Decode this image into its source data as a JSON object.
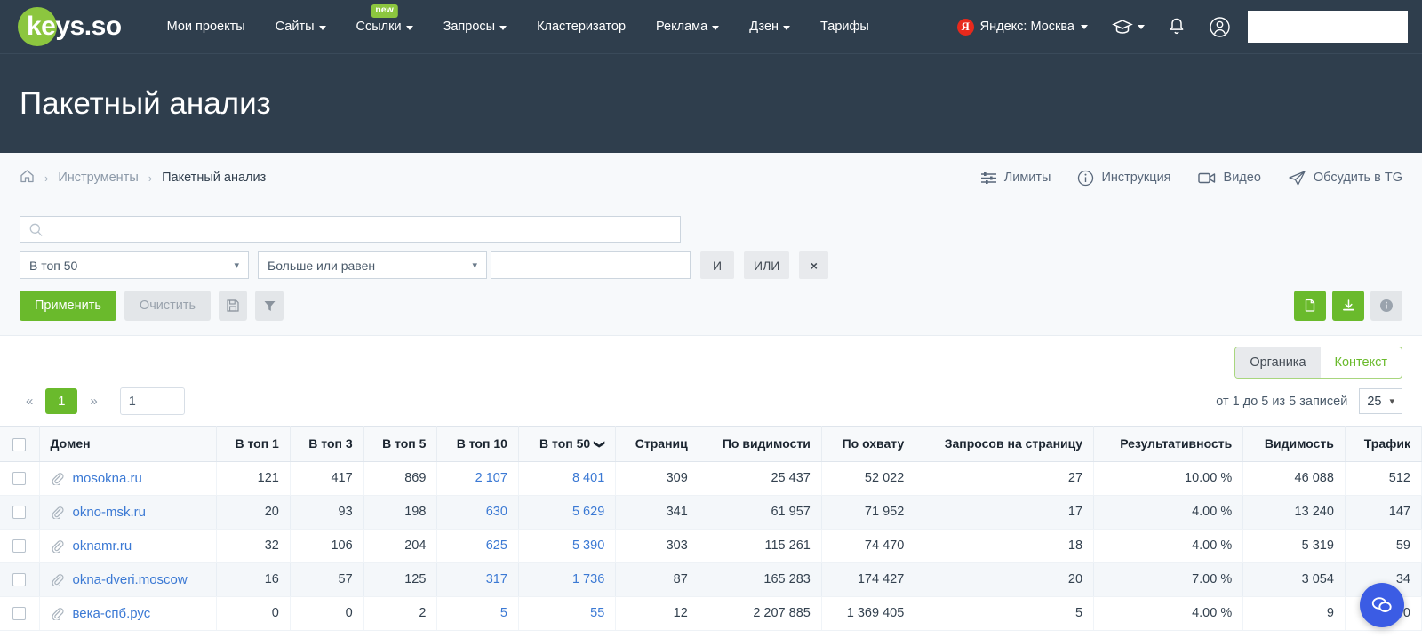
{
  "brand": {
    "logo_text": "keys.so",
    "logo_green": "#8cc63f"
  },
  "nav": {
    "items": [
      {
        "label": "Мои проекты",
        "caret": false,
        "badge": null
      },
      {
        "label": "Сайты",
        "caret": true,
        "badge": null
      },
      {
        "label": "Ссылки",
        "caret": true,
        "badge": "new"
      },
      {
        "label": "Запросы",
        "caret": true,
        "badge": null
      },
      {
        "label": "Кластеризатор",
        "caret": false,
        "badge": null
      },
      {
        "label": "Реклама",
        "caret": true,
        "badge": null
      },
      {
        "label": "Дзен",
        "caret": true,
        "badge": null
      },
      {
        "label": "Тарифы",
        "caret": false,
        "badge": null
      }
    ],
    "region": {
      "letter": "Я",
      "label": "Яндекс: Москва"
    },
    "user_search_value": ""
  },
  "header": {
    "title": "Пакетный анализ"
  },
  "breadcrumb": {
    "home": "home-icon",
    "items": [
      {
        "label": "Инструменты",
        "current": false
      },
      {
        "label": "Пакетный анализ",
        "current": true
      }
    ],
    "actions": [
      {
        "label": "Лимиты",
        "icon": "sliders-icon"
      },
      {
        "label": "Инструкция",
        "icon": "info-circle-icon"
      },
      {
        "label": "Видео",
        "icon": "video-camera-icon"
      },
      {
        "label": "Обсудить в TG",
        "icon": "telegram-send-icon"
      }
    ]
  },
  "filters": {
    "search_value": "",
    "search_placeholder": "",
    "metric_select": "В топ 50",
    "operator_select": "Больше или равен",
    "value_input": "",
    "value_placeholder": "",
    "and_label": "И",
    "or_label": "ИЛИ",
    "remove_label": "×",
    "apply_label": "Применить",
    "clear_label": "Очистить",
    "save_icon": "floppy-disk-icon",
    "filter_icon": "funnel-icon",
    "export_copy_icon": "document-copy-icon",
    "export_download_icon": "download-icon",
    "info_icon": "info-icon"
  },
  "tabs": {
    "items": [
      {
        "label": "Органика",
        "active": true
      },
      {
        "label": "Контекст",
        "active": false
      }
    ]
  },
  "pagination": {
    "prev": "«",
    "next": "»",
    "current_page": "1",
    "page_input_value": "1",
    "records_info": "от 1 до 5 из 5 записей",
    "page_size": "25"
  },
  "table": {
    "columns": [
      {
        "label": "Домен",
        "align": "left"
      },
      {
        "label": "В топ 1",
        "align": "right"
      },
      {
        "label": "В топ 3",
        "align": "right"
      },
      {
        "label": "В топ 5",
        "align": "right"
      },
      {
        "label": "В топ 10",
        "align": "right"
      },
      {
        "label": "В топ 50",
        "align": "right",
        "sorted": "desc"
      },
      {
        "label": "Страниц",
        "align": "right"
      },
      {
        "label": "По видимости",
        "align": "right"
      },
      {
        "label": "По охвату",
        "align": "right"
      },
      {
        "label": "Запросов на страницу",
        "align": "right"
      },
      {
        "label": "Результативность",
        "align": "right"
      },
      {
        "label": "Видимость",
        "align": "right"
      },
      {
        "label": "Трафик",
        "align": "right"
      }
    ],
    "rows": [
      {
        "domain": "mosokna.ru",
        "top1": "121",
        "top3": "417",
        "top5": "869",
        "top10": "2 107",
        "top50": "8 401",
        "pages": "309",
        "by_visibility": "25 437",
        "by_coverage": "52 022",
        "queries_per_page": "27",
        "effectiveness": "10.00 %",
        "visibility": "46 088",
        "traffic": "512"
      },
      {
        "domain": "okno-msk.ru",
        "top1": "20",
        "top3": "93",
        "top5": "198",
        "top10": "630",
        "top50": "5 629",
        "pages": "341",
        "by_visibility": "61 957",
        "by_coverage": "71 952",
        "queries_per_page": "17",
        "effectiveness": "4.00 %",
        "visibility": "13 240",
        "traffic": "147"
      },
      {
        "domain": "oknamr.ru",
        "top1": "32",
        "top3": "106",
        "top5": "204",
        "top10": "625",
        "top50": "5 390",
        "pages": "303",
        "by_visibility": "115 261",
        "by_coverage": "74 470",
        "queries_per_page": "18",
        "effectiveness": "4.00 %",
        "visibility": "5 319",
        "traffic": "59"
      },
      {
        "domain": "okna-dveri.moscow",
        "top1": "16",
        "top3": "57",
        "top5": "125",
        "top10": "317",
        "top50": "1 736",
        "pages": "87",
        "by_visibility": "165 283",
        "by_coverage": "174 427",
        "queries_per_page": "20",
        "effectiveness": "7.00 %",
        "visibility": "3 054",
        "traffic": "34"
      },
      {
        "domain": "века-спб.рус",
        "top1": "0",
        "top3": "0",
        "top5": "2",
        "top10": "5",
        "top50": "55",
        "pages": "12",
        "by_visibility": "2 207 885",
        "by_coverage": "1 369 405",
        "queries_per_page": "5",
        "effectiveness": "4.00 %",
        "visibility": "9",
        "traffic": "0"
      }
    ]
  },
  "chat": {
    "icon": "chat-bubble-icon"
  },
  "colors": {
    "nav_bg": "#2f3e4d",
    "accent_green": "#6aba2c",
    "link_blue": "#3b79d4",
    "chat_blue": "#3b5ce4"
  }
}
